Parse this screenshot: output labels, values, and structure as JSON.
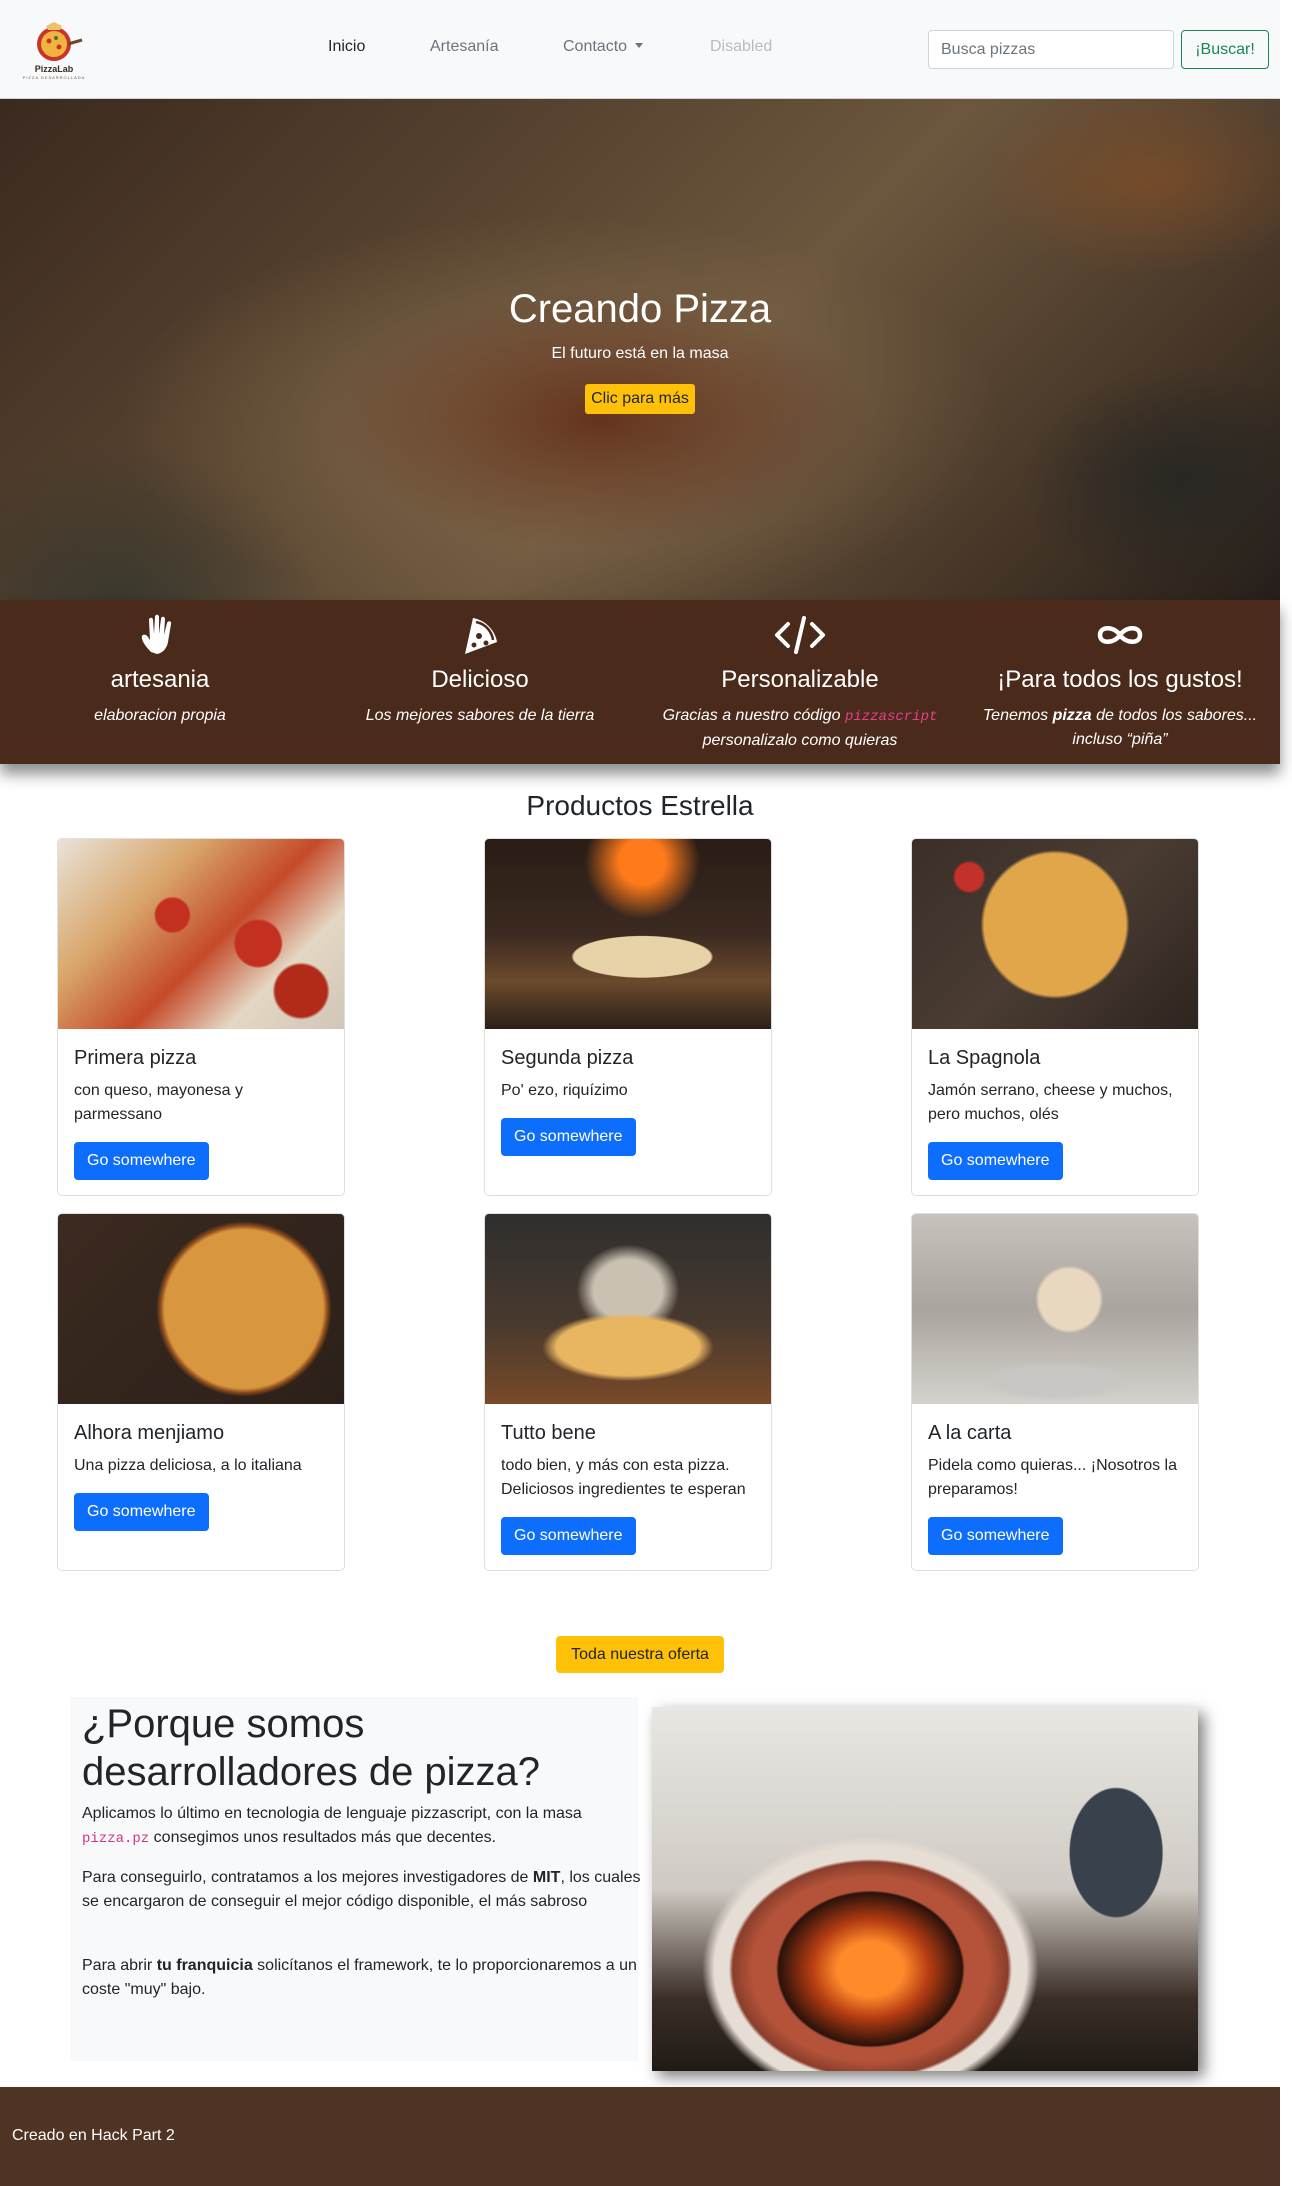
{
  "brand": {
    "name": "PizzaLab",
    "tagline": "PIZZA DESARROLLADA"
  },
  "nav": {
    "items": [
      {
        "label": "Inicio",
        "state": "active"
      },
      {
        "label": "Artesanía",
        "state": "normal"
      },
      {
        "label": "Contacto",
        "state": "dropdown"
      },
      {
        "label": "Disabled",
        "state": "disabled"
      }
    ],
    "search_placeholder": "Busca pizzas",
    "search_button": "¡Buscar!"
  },
  "hero": {
    "title": "Creando Pizza",
    "subtitle": "El futuro está en la masa",
    "button": "Clic para más"
  },
  "features": [
    {
      "icon": "hand-icon",
      "title": "artesania",
      "desc": "elaboracion propia"
    },
    {
      "icon": "pizza-slice-icon",
      "title": "Delicioso",
      "desc": "Los mejores sabores de la tierra"
    },
    {
      "icon": "code-icon",
      "title": "Personalizable",
      "desc_before": "Gracias a nuestro código",
      "code": "pizzascript",
      "desc_after": "personalizalo como quieras"
    },
    {
      "icon": "infinity-icon",
      "title": "¡Para todos los gustos!",
      "desc_before": "Tenemos",
      "bold": "pizza",
      "desc_after": "de todos los sabores... incluso “piña”"
    }
  ],
  "products": {
    "title": "Productos Estrella",
    "cards": [
      {
        "title": "Primera pizza",
        "text": "con queso, mayonesa y parmessano",
        "button": "Go somewhere"
      },
      {
        "title": "Segunda pizza",
        "text": "Po' ezo, riquízimo",
        "button": "Go somewhere"
      },
      {
        "title": "La Spagnola",
        "text": "Jamón serrano, cheese y muchos, pero muchos, olés",
        "button": "Go somewhere"
      },
      {
        "title": "Alhora menjiamo",
        "text": "Una pizza deliciosa, a lo italiana",
        "button": "Go somewhere"
      },
      {
        "title": "Tutto bene",
        "text": "todo bien, y más con esta pizza. Deliciosos ingredientes te esperan",
        "button": "Go somewhere"
      },
      {
        "title": "A la carta",
        "text": "Pidela como quieras... ¡Nosotros la preparamos!",
        "button": "Go somewhere"
      }
    ],
    "all_button": "Toda nuestra oferta"
  },
  "why": {
    "title": "¿Porque somos desarrolladores de pizza?",
    "p1_before": "Aplicamos lo último en tecnologia de lenguaje pizzascript, con la masa",
    "p1_code": "pizza.pz",
    "p1_after": "consegimos unos resultados más que decentes.",
    "p2_before": "Para conseguirlo, contratamos a los mejores investigadores de",
    "p2_bold": "MIT",
    "p2_after": ", los cuales se encargaron de conseguir el mejor código disponible, el más sabroso",
    "p3_before": "Para abrir",
    "p3_bold": "tu franquicia",
    "p3_after": "solicítanos el framework, te lo proporcionaremos a un coste \"muy\" bajo."
  },
  "footer": {
    "text": "Creado en Hack Part 2"
  },
  "colors": {
    "brown": "#4a2a1b",
    "footer": "#4f3423",
    "yellow": "#ffc107",
    "blue": "#0d6efd",
    "green": "#198754"
  }
}
